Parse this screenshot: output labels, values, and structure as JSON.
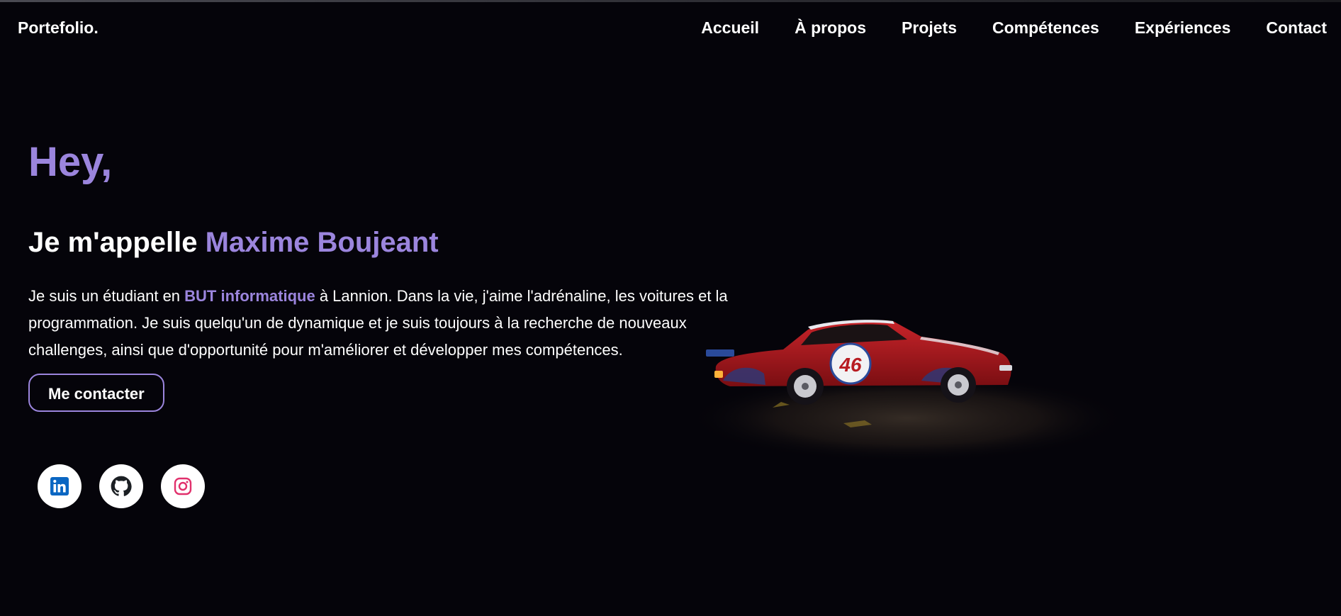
{
  "header": {
    "logo": "Portefolio.",
    "nav": [
      "Accueil",
      "À propos",
      "Projets",
      "Compétences",
      "Expériences",
      "Contact"
    ]
  },
  "hero": {
    "greeting": "Hey,",
    "intro_prefix": "Je m'appelle ",
    "name": "Maxime Boujeant",
    "bio_part1": "Je suis un étudiant en ",
    "bio_highlight": "BUT informatique",
    "bio_part2": " à Lannion. Dans la vie, j'aime l'adrénaline, les voitures et la programmation. Je suis quelqu'un de dynamique et je suis toujours à la recherche de nouveaux challenges, ainsi que d'opportunité pour m'améliorer et développer mes compétences.",
    "cta_label": "Me contacter"
  },
  "car": {
    "number": "46"
  },
  "socials": [
    {
      "name": "linkedin-icon",
      "color": "#0a66c2"
    },
    {
      "name": "github-icon",
      "color": "#1b1f23"
    },
    {
      "name": "instagram-icon",
      "color": "#e1306c"
    }
  ],
  "colors": {
    "accent": "#9b85dd",
    "background": "#05040a",
    "text": "#ffffff"
  }
}
